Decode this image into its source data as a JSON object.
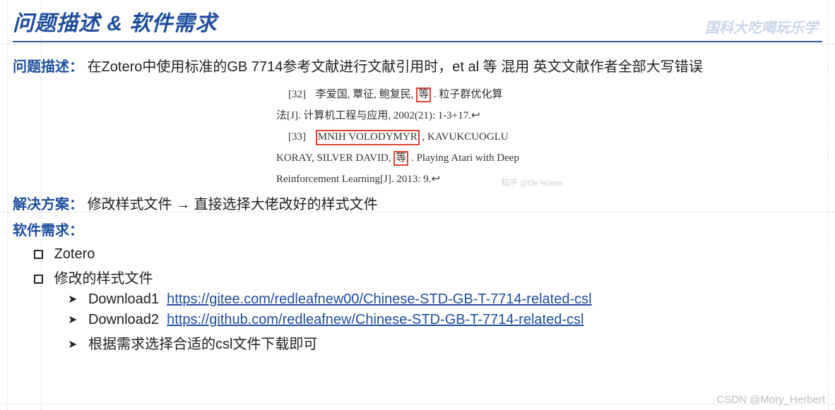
{
  "header": {
    "title": "问题描述 & 软件需求",
    "top_watermark": "国科大吃喝玩乐学"
  },
  "problem": {
    "label": "问题描述：",
    "text": "在Zotero中使用标准的GB 7714参考文献进行文献引用时，et al 等 混用 英文文献作者全部大写错误"
  },
  "refs": {
    "line1_num": "[32]",
    "line1_a": "李爱国, 覃征, 鲍复民,",
    "line1_box": "等",
    "line1_b": ". 粒子群优化算",
    "line2": "法[J]. 计算机工程与应用, 2002(21): 1-3+17.↩",
    "line3_num": "[33]",
    "line3_under": "MNIH   VOLODYMYR",
    "line3_b": ",   KAVUKCUOGLU",
    "line4_a": "KORAY, SILVER DAVID, ",
    "line4_box": "等",
    "line4_b": ". Playing Atari with Deep",
    "line5": "Reinforcement Learning[J]. 2013: 9.↩",
    "faint_mark": "知乎 @De Winter"
  },
  "solution": {
    "label": "解决方案：",
    "text": "修改样式文件 → 直接选择大佬改好的样式文件"
  },
  "needs": {
    "label": "软件需求：",
    "item1": "Zotero",
    "item2": "修改的样式文件",
    "dl1_label": "Download1",
    "dl1_url": "https://gitee.com/redleafnew00/Chinese-STD-GB-T-7714-related-csl",
    "dl2_label": "Download2",
    "dl2_url": "https://github.com/redleafnew/Chinese-STD-GB-T-7714-related-csl",
    "note": "根据需求选择合适的csl文件下载即可"
  },
  "footer_watermark": "CSDN @Mory_Herbert"
}
